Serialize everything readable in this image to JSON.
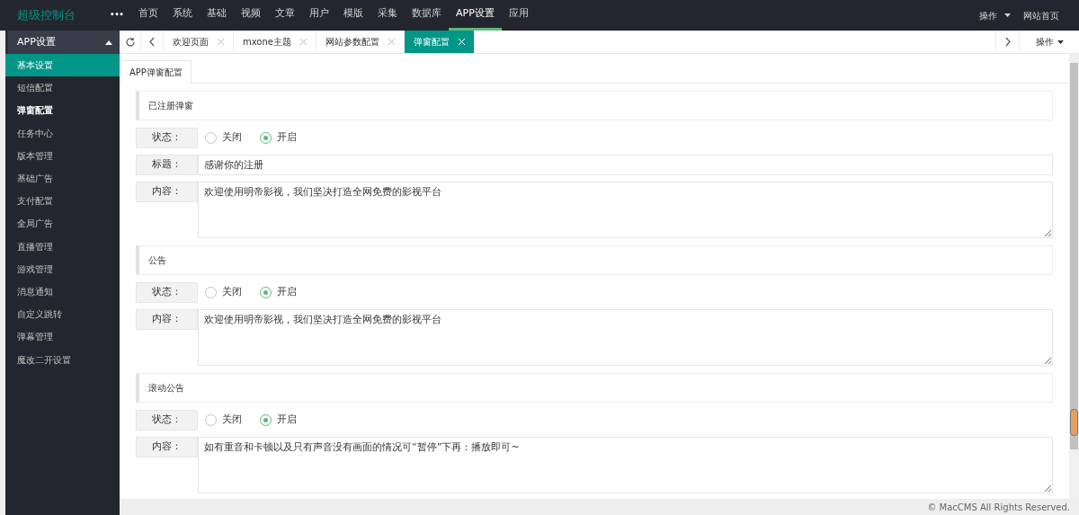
{
  "top_nav": {
    "brand": "超级控制台",
    "more": "•••",
    "items": [
      {
        "label": "首页",
        "selected": false
      },
      {
        "label": "系统",
        "selected": false
      },
      {
        "label": "基础",
        "selected": false
      },
      {
        "label": "视频",
        "selected": false
      },
      {
        "label": "文章",
        "selected": false
      },
      {
        "label": "用户",
        "selected": false
      },
      {
        "label": "模版",
        "selected": false
      },
      {
        "label": "采集",
        "selected": false
      },
      {
        "label": "数据库",
        "selected": false
      },
      {
        "label": "APP设置",
        "selected": true
      },
      {
        "label": "应用",
        "selected": false
      }
    ],
    "right": [
      {
        "kind": "dropdown",
        "label": "操作"
      },
      {
        "kind": "link",
        "label": "网站首页"
      }
    ]
  },
  "sidebar": {
    "header": "APP设置",
    "expanded": true,
    "items": [
      {
        "label": "基本设置",
        "selected": true,
        "highlighted": false
      },
      {
        "label": "短信配置",
        "selected": false,
        "highlighted": false
      },
      {
        "label": "弹窗配置",
        "selected": false,
        "highlighted": true
      },
      {
        "label": "任务中心",
        "selected": false,
        "highlighted": false
      },
      {
        "label": "版本管理",
        "selected": false,
        "highlighted": false
      },
      {
        "label": "基础广告",
        "selected": false,
        "highlighted": false
      },
      {
        "label": "支付配置",
        "selected": false,
        "highlighted": false
      },
      {
        "label": "全局广告",
        "selected": false,
        "highlighted": false
      },
      {
        "label": "直播管理",
        "selected": false,
        "highlighted": false
      },
      {
        "label": "游戏管理",
        "selected": false,
        "highlighted": false
      },
      {
        "label": "消息通知",
        "selected": false,
        "highlighted": false
      },
      {
        "label": "自定义跳转",
        "selected": false,
        "highlighted": false
      },
      {
        "label": "弹幕管理",
        "selected": false,
        "highlighted": false
      },
      {
        "label": "魔改二开设置",
        "selected": false,
        "highlighted": false
      }
    ]
  },
  "tab_bar": {
    "tabs": [
      {
        "label": "欢迎页面",
        "selected": false
      },
      {
        "label": "mxone主题",
        "selected": false
      },
      {
        "label": "网站参数配置",
        "selected": false
      },
      {
        "label": "弹窗配置",
        "selected": true
      }
    ],
    "action": "操作"
  },
  "page_tab": "APP弹窗配置",
  "sections": [
    {
      "heading": "已注册弹窗",
      "fields": [
        {
          "kind": "radio",
          "label": "状态：",
          "options": [
            {
              "label": "关闭",
              "selected": false
            },
            {
              "label": "开启",
              "selected": true
            }
          ]
        },
        {
          "kind": "text",
          "label": "标题：",
          "value": "感谢你的注册"
        },
        {
          "kind": "textarea",
          "label": "内容：",
          "value": "欢迎使用明帝影视，我们坚决打造全网免费的影视平台"
        }
      ]
    },
    {
      "heading": "公告",
      "fields": [
        {
          "kind": "radio",
          "label": "状态：",
          "options": [
            {
              "label": "关闭",
              "selected": false
            },
            {
              "label": "开启",
              "selected": true
            }
          ]
        },
        {
          "kind": "textarea",
          "label": "内容：",
          "value": "欢迎使用明帝影视，我们坚决打造全网免费的影视平台"
        }
      ]
    },
    {
      "heading": "滚动公告",
      "fields": [
        {
          "kind": "radio",
          "label": "状态：",
          "options": [
            {
              "label": "关闭",
              "selected": false
            },
            {
              "label": "开启",
              "selected": true
            }
          ]
        },
        {
          "kind": "textarea",
          "label": "内容：",
          "value": "如有重音和卡顿以及只有声音没有画面的情况可“暂停”下再：播放即可~"
        }
      ]
    }
  ],
  "footer": "© MacCMS All Rights Reserved."
}
